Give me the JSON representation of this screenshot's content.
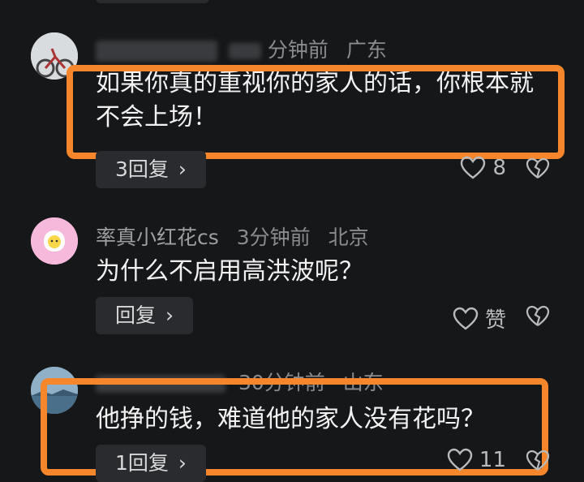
{
  "comments": [
    {
      "nickname": "",
      "time": "分钟前",
      "location": "广东",
      "text": "如果你真的重视你的家人的话，你根本就不会上场！",
      "reply_label": "3回复",
      "likes": "8"
    },
    {
      "nickname": "率真小红花cs",
      "time": "3分钟前",
      "location": "北京",
      "text": "为什么不启用高洪波呢？",
      "reply_label": "回复",
      "likes": "赞"
    },
    {
      "nickname": "",
      "time": "30分钟前",
      "location": "山东",
      "text": "他挣的钱，难道他的家人没有花吗？",
      "reply_label": "1回复",
      "likes": "11"
    }
  ],
  "icons": [
    "heart-icon",
    "broken-heart-icon",
    "chevron-right-icon"
  ],
  "colors": {
    "highlight": "#f5862b",
    "background": "#161718"
  }
}
